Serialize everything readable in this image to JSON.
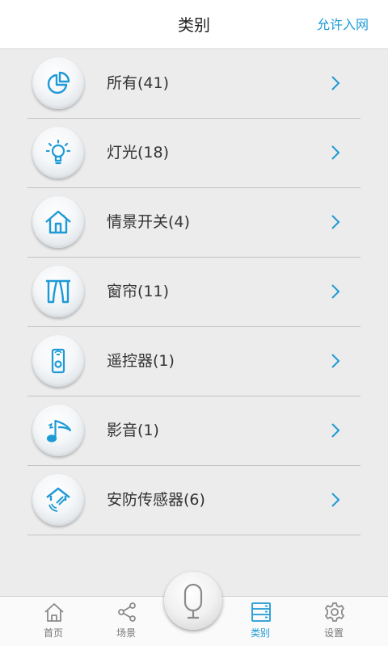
{
  "header": {
    "title": "类别",
    "action_label": "允许入网"
  },
  "categories": [
    {
      "label": "所有(41)",
      "icon": "pie-chart-icon"
    },
    {
      "label": "灯光(18)",
      "icon": "light-bulb-icon"
    },
    {
      "label": "情景开关(4)",
      "icon": "house-icon"
    },
    {
      "label": "窗帘(11)",
      "icon": "curtain-icon"
    },
    {
      "label": "遥控器(1)",
      "icon": "remote-control-icon"
    },
    {
      "label": "影音(1)",
      "icon": "music-note-icon"
    },
    {
      "label": "安防传感器(6)",
      "icon": "security-sensor-icon"
    }
  ],
  "bottom_nav": {
    "tabs": [
      {
        "label": "首页",
        "icon": "home-icon"
      },
      {
        "label": "场景",
        "icon": "share-icon"
      },
      {
        "label": "类别",
        "icon": "list-icon",
        "active": true
      },
      {
        "label": "设置",
        "icon": "gear-icon"
      }
    ],
    "center_button_icon": "microphone-icon"
  },
  "colors": {
    "accent": "#1e9ad6",
    "background": "#ececec",
    "text": "#333333"
  }
}
